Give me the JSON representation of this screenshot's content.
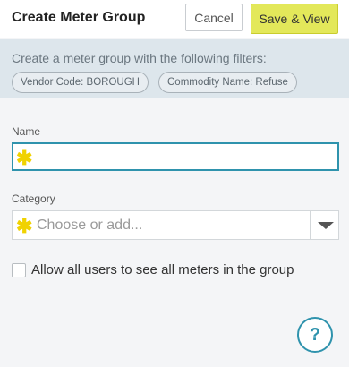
{
  "header": {
    "title": "Create Meter Group",
    "cancel_label": "Cancel",
    "save_label": "Save & View"
  },
  "filters": {
    "description": "Create a meter group with the following filters:",
    "chips": [
      "Vendor Code: BOROUGH",
      "Commodity Name: Refuse"
    ]
  },
  "form": {
    "name_label": "Name",
    "name_value": "",
    "category_label": "Category",
    "category_placeholder": "Choose or add...",
    "share_checkbox_label": "Allow all users to see all meters in the group",
    "share_checked": false
  },
  "help": {
    "label": "?"
  },
  "colors": {
    "accent": "#2f93ad",
    "save_button": "#e3e85a",
    "required_star": "#f0d200",
    "filter_bar": "#dde6ec"
  }
}
